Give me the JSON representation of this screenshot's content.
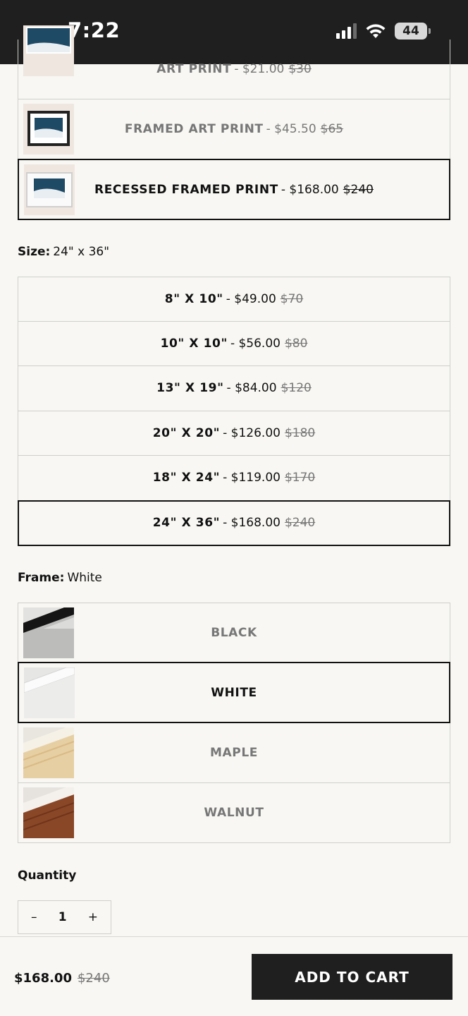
{
  "status_bar": {
    "time": "7:22",
    "battery": "44"
  },
  "print_types": [
    {
      "name": "ART PRINT",
      "price": "- $21.00",
      "old_price": "$30",
      "selected": false
    },
    {
      "name": "FRAMED ART PRINT",
      "price": "- $45.50",
      "old_price": "$65",
      "selected": false
    },
    {
      "name": "RECESSED FRAMED PRINT",
      "price": "- $168.00",
      "old_price": "$240",
      "selected": true
    }
  ],
  "size": {
    "label": "Size:",
    "value": "24\" x 36\"",
    "options": [
      {
        "name": "8\" X 10\"",
        "price": "- $49.00",
        "old_price": "$70",
        "selected": false
      },
      {
        "name": "10\" X 10\"",
        "price": "- $56.00",
        "old_price": "$80",
        "selected": false
      },
      {
        "name": "13\" X 19\"",
        "price": "- $84.00",
        "old_price": "$120",
        "selected": false
      },
      {
        "name": "20\" X 20\"",
        "price": "- $126.00",
        "old_price": "$180",
        "selected": false
      },
      {
        "name": "18\" X 24\"",
        "price": "- $119.00",
        "old_price": "$170",
        "selected": false
      },
      {
        "name": "24\" X 36\"",
        "price": "- $168.00",
        "old_price": "$240",
        "selected": true
      }
    ]
  },
  "frame": {
    "label": "Frame:",
    "value": "White",
    "options": [
      {
        "name": "BLACK",
        "color": "#1a1a1a",
        "selected": false
      },
      {
        "name": "WHITE",
        "color": "#f2f2f2",
        "selected": true
      },
      {
        "name": "MAPLE",
        "color": "#e9d3ab",
        "selected": false
      },
      {
        "name": "WALNUT",
        "color": "#8c4a2c",
        "selected": false
      }
    ]
  },
  "quantity": {
    "label": "Quantity",
    "value": "1",
    "minus": "–",
    "plus": "+"
  },
  "footer": {
    "total": "$168.00",
    "old_total": "$240",
    "cta": "ADD TO CART"
  }
}
